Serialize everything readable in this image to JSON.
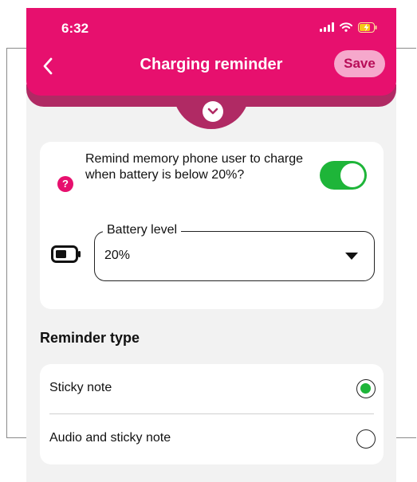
{
  "status_bar": {
    "time": "6:32",
    "signal_icon": "cellular-signal-icon",
    "wifi_icon": "wifi-icon",
    "battery_icon": "battery-charging-icon"
  },
  "header": {
    "title": "Charging reminder",
    "back_icon": "chevron-left-icon",
    "save_label": "Save",
    "expand_icon": "chevron-down-circle-icon"
  },
  "reminder_settings": {
    "help_icon_text": "?",
    "question": "Remind memory phone user to charge when battery is below 20%?",
    "toggle_on": true,
    "battery_field": {
      "icon": "battery-icon",
      "label": "Battery level",
      "value": "20%"
    }
  },
  "reminder_type": {
    "title": "Reminder type",
    "options": [
      {
        "label": "Sticky note",
        "selected": true
      },
      {
        "label": "Audio and sticky note",
        "selected": false
      }
    ]
  },
  "colors": {
    "brand": "#e7106e",
    "drawer": "#b02a64",
    "toggle_on": "#1eb539",
    "save_bg": "#f6a8cc",
    "background": "#f2f2f2"
  }
}
